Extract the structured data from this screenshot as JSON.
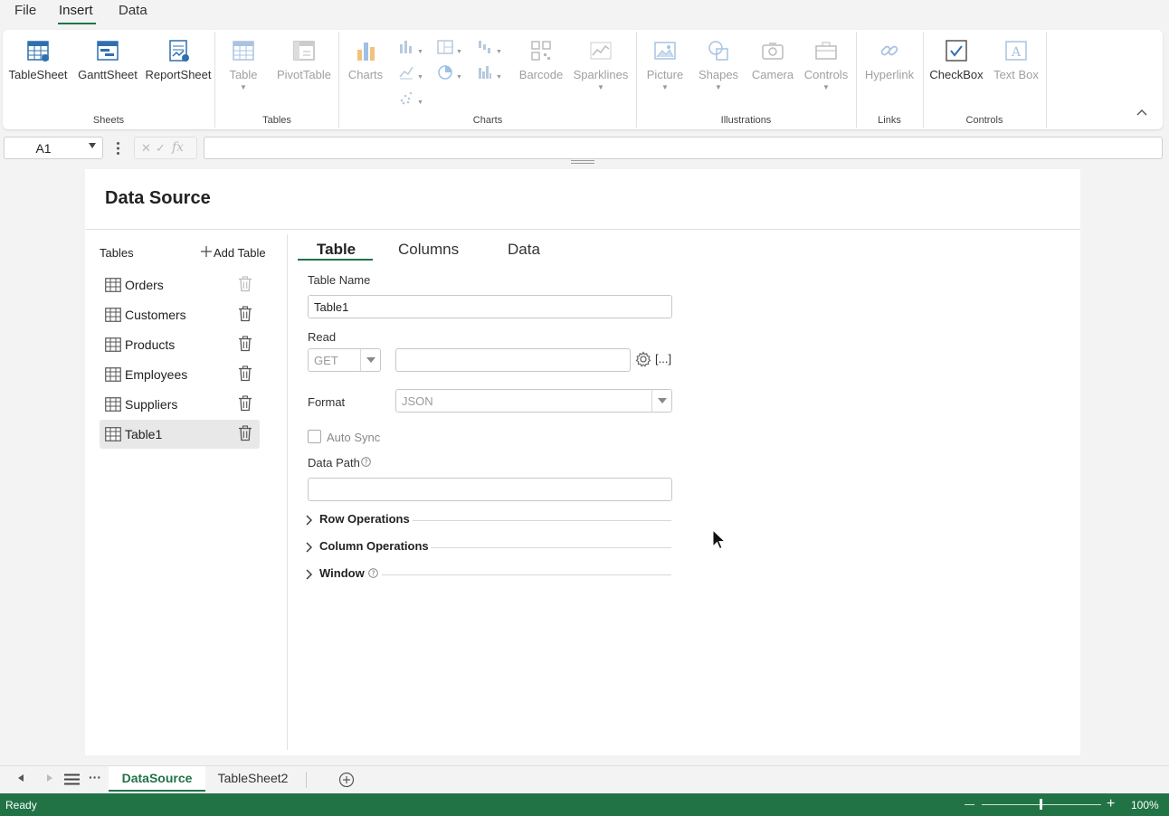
{
  "menu": {
    "tabs": [
      "File",
      "Insert",
      "Data"
    ],
    "active": "Insert"
  },
  "ribbon": {
    "sheets": {
      "buttons": [
        "TableSheet",
        "GanttSheet",
        "ReportSheet"
      ],
      "label": "Sheets"
    },
    "tables": {
      "buttons": [
        "Table",
        "PivotTable"
      ],
      "label": "Tables"
    },
    "charts": {
      "buttons": [
        "Charts",
        "Barcode",
        "Sparklines"
      ],
      "label": "Charts"
    },
    "illustrations": {
      "buttons": [
        "Picture",
        "Shapes",
        "Camera",
        "Controls"
      ],
      "label": "Illustrations"
    },
    "links": {
      "buttons": [
        "Hyperlink"
      ],
      "label": "Links"
    },
    "controls": {
      "buttons": [
        "CheckBox",
        "Text Box"
      ],
      "label": "Controls"
    }
  },
  "formula_bar": {
    "cell_ref": "A1",
    "fx": "fx",
    "value": ""
  },
  "panel": {
    "title": "Data Source",
    "tables_label": "Tables",
    "add_table": "Add Table",
    "tables": [
      "Orders",
      "Customers",
      "Products",
      "Employees",
      "Suppliers",
      "Table1"
    ],
    "selected_table": "Table1",
    "tabs": [
      "Table",
      "Columns",
      "Data"
    ],
    "active_tab": "Table",
    "form": {
      "table_name_label": "Table Name",
      "table_name_value": "Table1",
      "read_label": "Read",
      "read_method": "GET",
      "read_url": "",
      "read_more": "[...]",
      "format_label": "Format",
      "format_value": "JSON",
      "auto_sync_label": "Auto Sync",
      "auto_sync_checked": false,
      "data_path_label": "Data Path",
      "data_path_value": ""
    },
    "sections": [
      "Row Operations",
      "Column Operations",
      "Window"
    ]
  },
  "sheet_tabs": {
    "tabs": [
      "DataSource",
      "TableSheet2"
    ],
    "active": "DataSource"
  },
  "status": {
    "text": "Ready",
    "zoom": "100%"
  },
  "colors": {
    "accent": "#217346",
    "ribbon_icon": "#2f6fb0"
  }
}
